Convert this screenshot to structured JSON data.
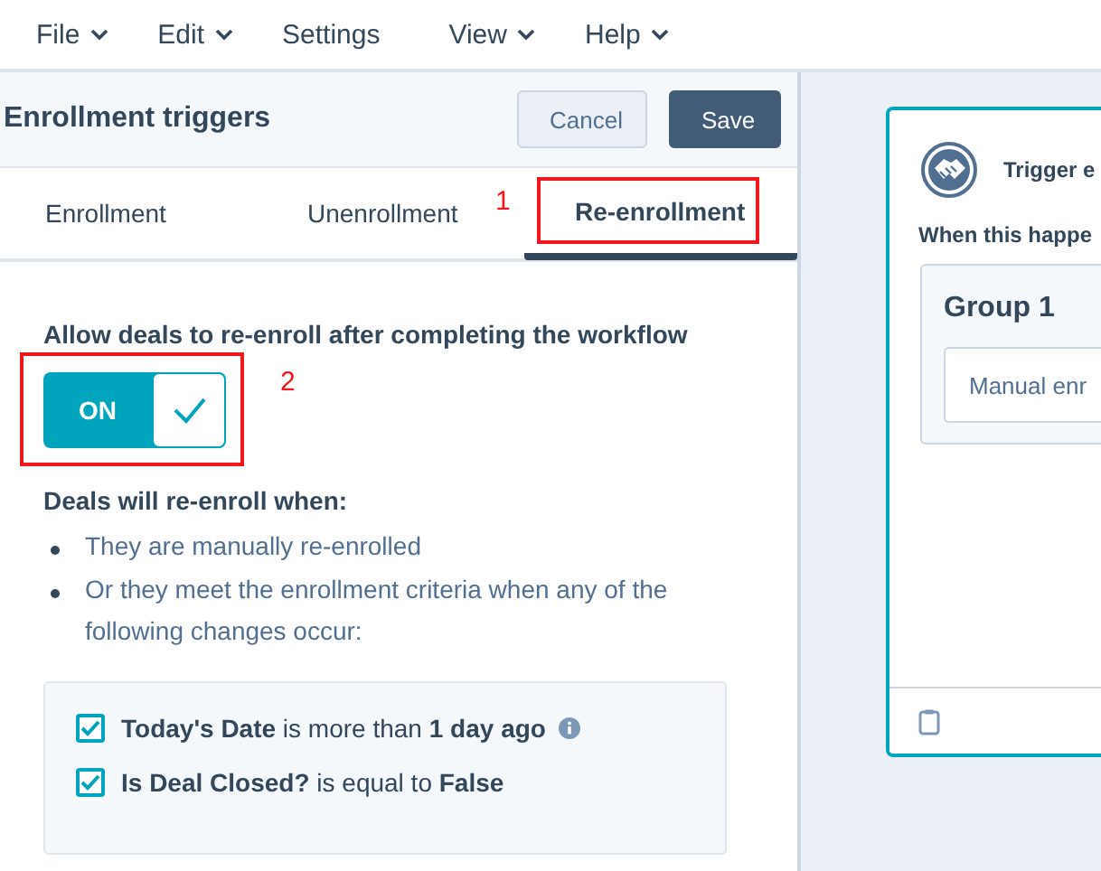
{
  "menu": [
    {
      "label": "File",
      "dropdown": true
    },
    {
      "label": "Edit",
      "dropdown": true
    },
    {
      "label": "Settings",
      "dropdown": false
    },
    {
      "label": "View",
      "dropdown": true
    },
    {
      "label": "Help",
      "dropdown": true
    }
  ],
  "panel": {
    "title": "Enrollment triggers",
    "buttons": [
      {
        "label": "Cancel",
        "kind": "secondary"
      },
      {
        "label": "Save",
        "kind": "primary"
      }
    ],
    "tabs": [
      {
        "label": "Enrollment",
        "selected": false
      },
      {
        "label": "Unenrollment",
        "selected": false
      },
      {
        "label": "Re-enrollment",
        "selected": true,
        "annotation": "1"
      }
    ],
    "setting": {
      "label": "Allow deals to re-enroll after completing the workflow",
      "toggle_text": "ON",
      "on": true,
      "annotation": "2"
    },
    "subheading": "Deals will re-enroll when:",
    "bullets": [
      "They are manually re-enrolled",
      "Or they meet the enrollment criteria when any of the following changes occur:"
    ],
    "criteria": [
      {
        "text": "**Today's Date** is more than **1 day ago**",
        "checked": true,
        "info": true
      },
      {
        "text": "**Is Deal Closed?** is equal to **False**",
        "checked": true,
        "info": false
      }
    ]
  },
  "card": {
    "title": "Trigger e",
    "subtitle": "When this happe",
    "group": {
      "title": "Group 1",
      "item": "Manual enr"
    }
  }
}
